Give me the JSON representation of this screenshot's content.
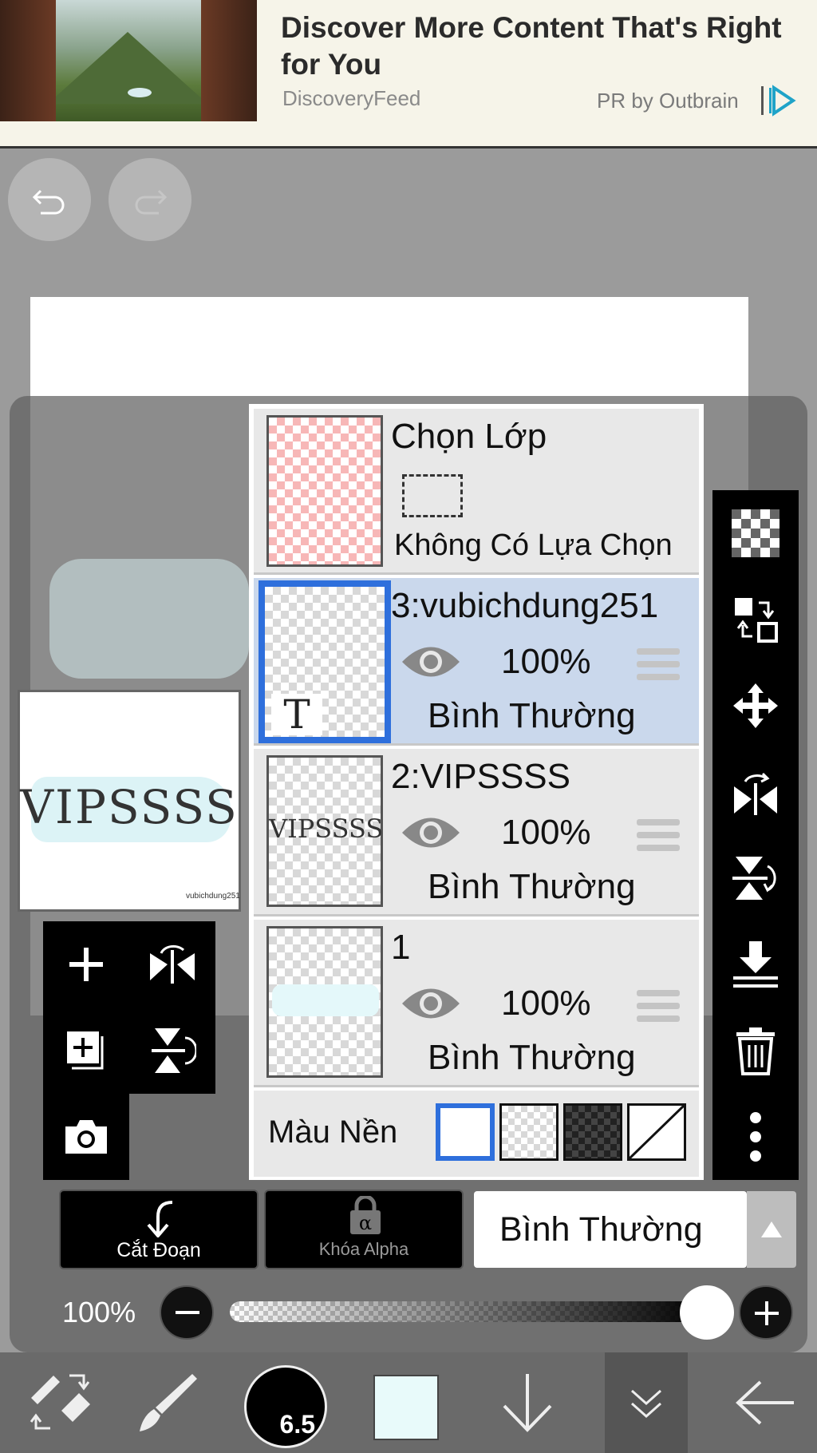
{
  "ad": {
    "title": "Discover More Content That's Right for You",
    "source": "DiscoveryFeed",
    "pr": "PR by Outbrain"
  },
  "canvas_preview": {
    "text": "VIPSSSS",
    "signature": "vubichdung251"
  },
  "layers": [
    {
      "name": "Chọn Lớp",
      "subtitle": "Không Có Lựa Chọn",
      "type": "selection"
    },
    {
      "name": "3:vubichdung251",
      "opacity": "100%",
      "mode": "Bình Thường",
      "selected": true,
      "thumb_glyph": "T"
    },
    {
      "name": "2:VIPSSSS",
      "opacity": "100%",
      "mode": "Bình Thường",
      "selected": false,
      "thumb_text": "VIPSSSS"
    },
    {
      "name": "1",
      "opacity": "100%",
      "mode": "Bình Thường",
      "selected": false
    }
  ],
  "background": {
    "label": "Màu Nền",
    "options": [
      "white",
      "transparent",
      "dark-checker",
      "none"
    ],
    "selected": "white"
  },
  "buttons": {
    "clip": "Cắt Đoạn",
    "alpha_lock": "Khóa Alpha"
  },
  "blend_mode": "Bình Thường",
  "opacity": {
    "label": "100%",
    "value": 1.0
  },
  "brush_size": "6.5",
  "colors": {
    "accent": "#2e6fdc",
    "selected_row": "#cad8ec",
    "current_color": "#e8fafa"
  },
  "icons": {
    "left_tools": [
      "add-layer-icon",
      "flip-horizontal-icon",
      "duplicate-layer-icon",
      "flip-vertical-icon",
      "camera-icon"
    ],
    "right_tools": [
      "checker-icon",
      "swap-icon",
      "move-icon",
      "flip-h-icon",
      "flip-v-icon",
      "merge-down-icon",
      "trash-icon",
      "more-icon"
    ],
    "bottom_tools": [
      "transform-icon",
      "brush-icon",
      "brush-size",
      "color",
      "down-arrow-icon",
      "collapse-icon",
      "back-icon"
    ]
  }
}
